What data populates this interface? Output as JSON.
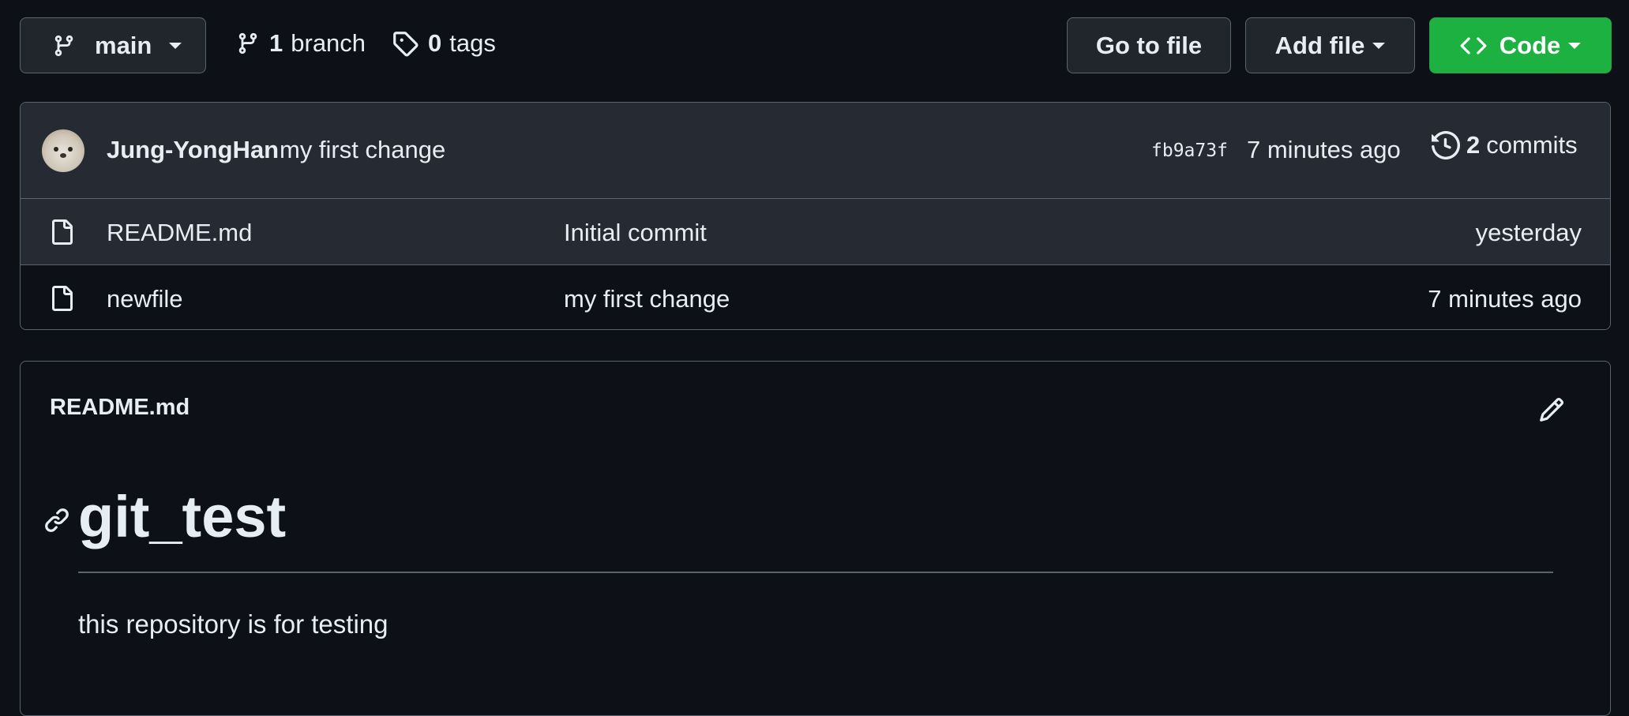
{
  "toolbar": {
    "branch_selector": "main",
    "branch_count": "1",
    "branch_label": "branch",
    "tag_count": "0",
    "tag_label": "tags",
    "go_to_file": "Go to file",
    "add_file": "Add file",
    "code": "Code"
  },
  "latest_commit": {
    "author": "Jung-YongHan",
    "message": "my first change",
    "sha": "fb9a73f",
    "time": "7 minutes ago",
    "commit_count": "2",
    "commit_label": "commits"
  },
  "files": [
    {
      "name": "README.md",
      "message": "Initial commit",
      "time": "yesterday"
    },
    {
      "name": "newfile",
      "message": "my first change",
      "time": "7 minutes ago"
    }
  ],
  "readme": {
    "filename": "README.md",
    "heading": "git_test",
    "body": "this repository is for testing"
  },
  "colors": {
    "background": "#0d1117",
    "panel": "#262b33",
    "border": "#5b6370",
    "code_button": "#1db141",
    "text": "#e6edf3"
  },
  "icons": [
    "branch-icon",
    "tag-icon",
    "chevron-down-icon",
    "code-icon",
    "history-icon",
    "file-icon",
    "pencil-icon",
    "link-icon"
  ]
}
